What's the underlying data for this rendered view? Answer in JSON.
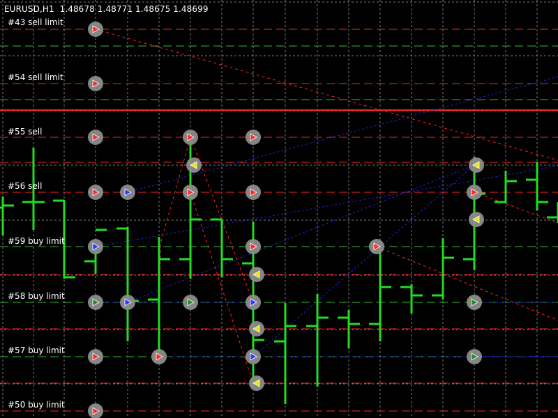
{
  "header": {
    "symbol": "EURUSD,H1",
    "ohlc": "1.48678 1.48771 1.48675 1.48699"
  },
  "colors": {
    "background": "#000000",
    "grid": "#7a7a7a",
    "bar": "#22dd22",
    "sell_line": "#ff2222",
    "buy_line": "#33bb33",
    "trend_line": "#2222dd",
    "arrow_red": "#ff2a2a",
    "arrow_blue": "#2a3cff",
    "arrow_green": "#1f8f1f",
    "arrow_yellow": "#e8e800",
    "marker_ring": "#8c8c8c"
  },
  "order_labels": [
    {
      "text": "#43 sell limit"
    },
    {
      "text": "#54 sell limit"
    },
    {
      "text": "#55 sell"
    },
    {
      "text": "#56 sell"
    },
    {
      "text": "#59 buy limit"
    },
    {
      "text": "#58 buy limit"
    },
    {
      "text": "#57 buy limit"
    },
    {
      "text": "#50 buy limit"
    }
  ]
}
